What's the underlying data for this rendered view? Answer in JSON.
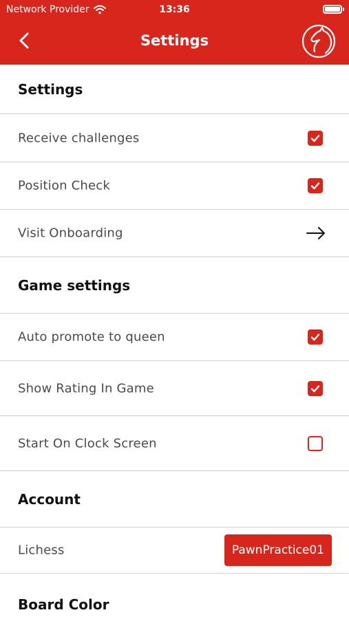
{
  "status_bar": {
    "carrier": "Network Provider",
    "time": "13:36"
  },
  "nav": {
    "title": "Settings"
  },
  "sections": {
    "settings": {
      "title": "Settings",
      "items": {
        "receive_challenges": {
          "label": "Receive challenges",
          "checked": true
        },
        "position_check": {
          "label": "Position Check",
          "checked": true
        },
        "visit_onboarding": {
          "label": "Visit Onboarding"
        }
      }
    },
    "game_settings": {
      "title": "Game settings",
      "items": {
        "auto_promote": {
          "label": "Auto promote to queen",
          "checked": true
        },
        "show_rating": {
          "label": "Show Rating In Game",
          "checked": true
        },
        "start_clock": {
          "label": "Start On Clock Screen",
          "checked": false
        }
      }
    },
    "account": {
      "title": "Account",
      "lichess": {
        "label": "Lichess",
        "username": "PawnPractice01"
      }
    },
    "board_color": {
      "title": "Board Color"
    }
  },
  "colors": {
    "accent": "#d9261c",
    "divider": "#cfcfcf"
  }
}
